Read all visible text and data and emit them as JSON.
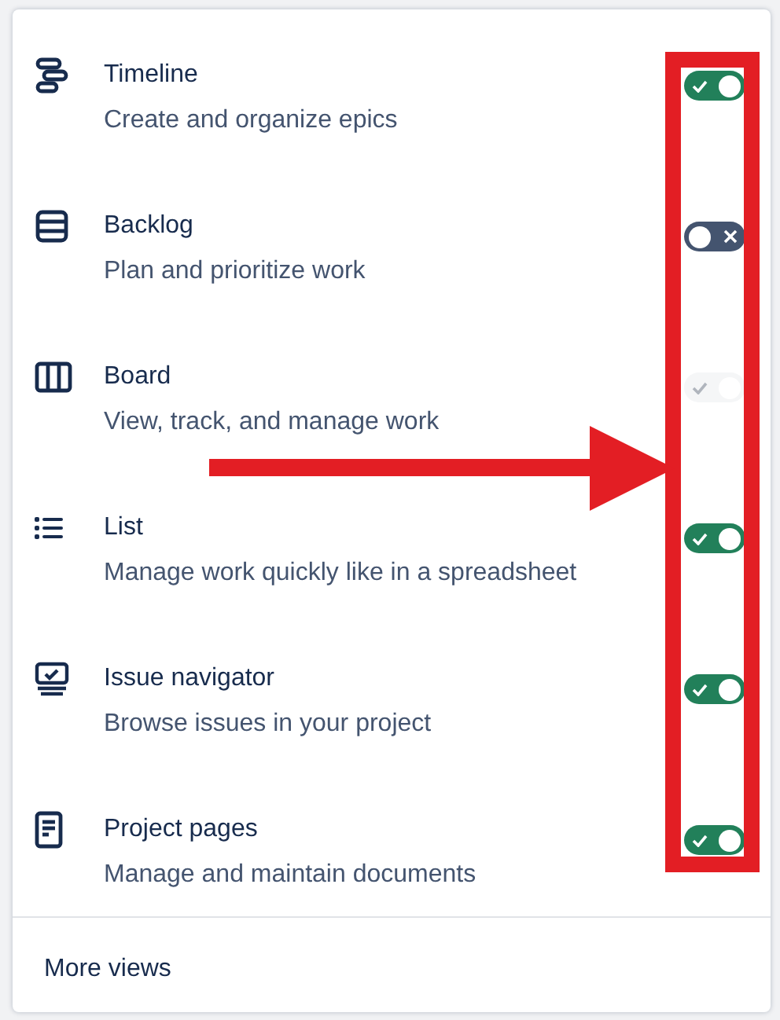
{
  "views": [
    {
      "title": "Timeline",
      "description": "Create and organize epics",
      "on": true,
      "disabled": false
    },
    {
      "title": "Backlog",
      "description": "Plan and prioritize work",
      "on": false,
      "disabled": false
    },
    {
      "title": "Board",
      "description": "View, track, and manage work",
      "on": true,
      "disabled": true
    },
    {
      "title": "List",
      "description": "Manage work quickly like in a spreadsheet",
      "on": true,
      "disabled": false
    },
    {
      "title": "Issue navigator",
      "description": "Browse issues in your project",
      "on": true,
      "disabled": false
    },
    {
      "title": "Project pages",
      "description": "Manage and maintain documents",
      "on": true,
      "disabled": false
    }
  ],
  "more_link": "More views"
}
